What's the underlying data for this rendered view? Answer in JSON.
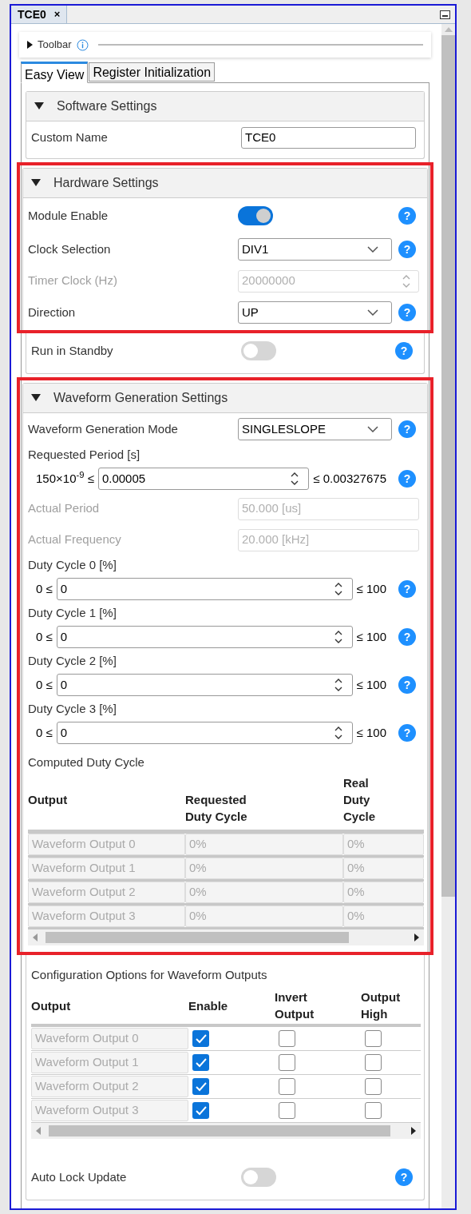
{
  "panel_tab": {
    "title": "TCE0",
    "close": "×"
  },
  "toolbar": {
    "label": "Toolbar",
    "expanded": false
  },
  "view_tabs": [
    {
      "label": "Easy View",
      "selected": true
    },
    {
      "label": "Register Initialization",
      "selected": false
    }
  ],
  "sections": [
    {
      "title": "Software Settings",
      "expanded": true,
      "highlighted": false,
      "items": [
        {
          "kind": "text",
          "label": "Custom Name",
          "value": "TCE0"
        }
      ]
    },
    {
      "title": "Hardware Settings",
      "expanded": true,
      "highlighted": true,
      "items": [
        {
          "kind": "toggle",
          "label": "Module Enable",
          "on": true,
          "help": "?"
        },
        {
          "kind": "dropdown",
          "label": "Clock Selection",
          "value": "DIV1",
          "help": "?"
        },
        {
          "kind": "spinner",
          "label": "Timer Clock (Hz)",
          "value": "20000000",
          "disabled": true
        },
        {
          "kind": "dropdown",
          "label": "Direction",
          "value": "UP",
          "help": "?"
        }
      ],
      "items_below_highlight": [
        {
          "kind": "toggle",
          "label": "Run in Standby",
          "on": false,
          "help": "?"
        }
      ]
    },
    {
      "title": "Waveform Generation Settings",
      "expanded": true,
      "highlighted": true,
      "items": [
        {
          "kind": "dropdown",
          "label": "Waveform Generation Mode",
          "value": "SINGLESLOPE",
          "help": "?"
        },
        {
          "kind": "range",
          "label": "Requested Period [s]",
          "min": "150×10$^{-9}$ ≤",
          "value": "0.00005",
          "max": "≤ 0.00327675",
          "help": "?"
        },
        {
          "kind": "readonly",
          "label": "Actual Period",
          "value": "50.000 [us]"
        },
        {
          "kind": "readonly",
          "label": "Actual Frequency",
          "value": "20.000 [kHz]"
        },
        {
          "kind": "range",
          "label": "Duty Cycle 0 [%]",
          "min": "0 ≤",
          "value": "0",
          "max": "≤ 100",
          "help": "?"
        },
        {
          "kind": "range",
          "label": "Duty Cycle 1 [%]",
          "min": "0 ≤",
          "value": "0",
          "max": "≤ 100",
          "help": "?"
        },
        {
          "kind": "range",
          "label": "Duty Cycle 2 [%]",
          "min": "0 ≤",
          "value": "0",
          "max": "≤ 100",
          "help": "?"
        },
        {
          "kind": "range",
          "label": "Duty Cycle 3 [%]",
          "min": "0 ≤",
          "value": "0",
          "max": "≤ 100",
          "help": "?"
        },
        {
          "kind": "table",
          "caption": "Computed Duty Cycle",
          "columns": [
            "Output",
            "Requested Duty Cycle",
            "Real Duty Cycle"
          ],
          "rows": [
            [
              "Waveform Output 0",
              "0%",
              "0%"
            ],
            [
              "Waveform Output 1",
              "0%",
              "0%"
            ],
            [
              "Waveform Output 2",
              "0%",
              "0%"
            ],
            [
              "Waveform Output 3",
              "0%",
              "0%"
            ]
          ]
        }
      ],
      "items_below_highlight": [
        {
          "kind": "checktable",
          "caption": "Configuration Options for Waveform Outputs",
          "columns": [
            "Output",
            "Enable",
            "Invert Output",
            "Output High"
          ],
          "rows": [
            {
              "output": "Waveform Output 0",
              "checked": [
                true,
                false,
                false
              ]
            },
            {
              "output": "Waveform Output 1",
              "checked": [
                true,
                false,
                false
              ]
            },
            {
              "output": "Waveform Output 2",
              "checked": [
                true,
                false,
                false
              ]
            },
            {
              "output": "Waveform Output 3",
              "checked": [
                true,
                false,
                false
              ]
            }
          ]
        },
        {
          "kind": "toggle",
          "label": "Auto Lock Update",
          "on": false,
          "help": "?"
        }
      ]
    }
  ]
}
